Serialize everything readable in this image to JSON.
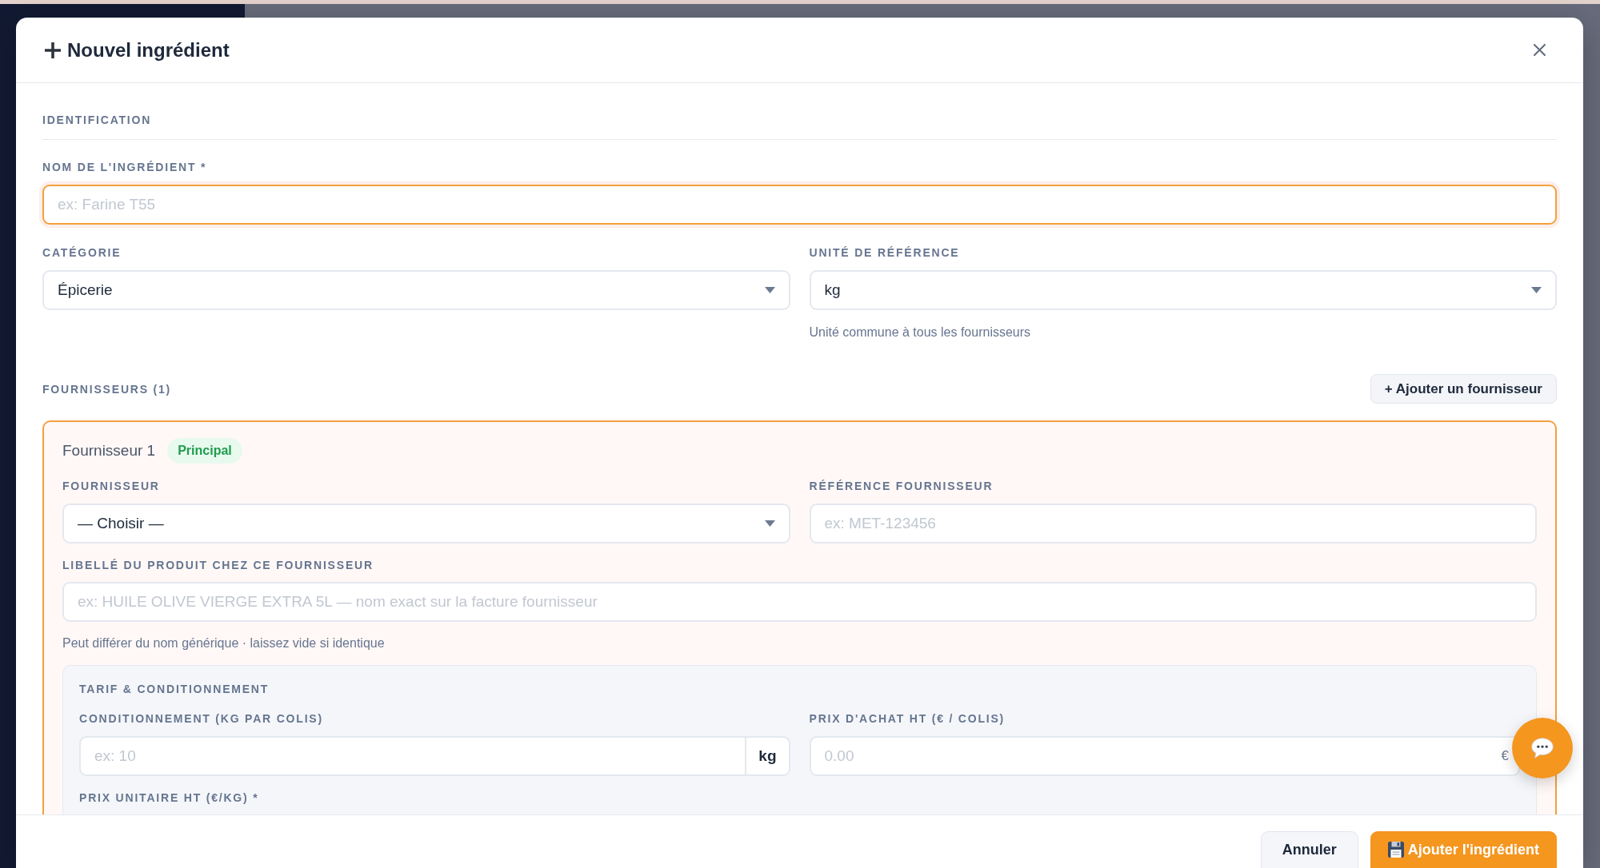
{
  "dialog": {
    "title": "Nouvel ingrédient"
  },
  "identification": {
    "heading": "IDENTIFICATION",
    "name_field": {
      "label": "NOM DE L'INGRÉDIENT *",
      "placeholder": "ex: Farine T55",
      "focused": true
    },
    "category_field": {
      "label": "CATÉGORIE",
      "value": "Épicerie"
    },
    "unit_field": {
      "label": "UNITÉ DE RÉFÉRENCE",
      "value": "kg",
      "hint": "Unité commune à tous les fournisseurs"
    }
  },
  "suppliers": {
    "heading": "FOURNISSEURS (1)",
    "add_button": "+ Ajouter un fournisseur",
    "items": [
      {
        "title": "Fournisseur 1",
        "badge": "Principal",
        "primary": true,
        "supplier_field": {
          "label": "FOURNISSEUR",
          "value": "— Choisir —"
        },
        "reference_field": {
          "label": "RÉFÉRENCE FOURNISSEUR",
          "placeholder": "ex: MET-123456"
        },
        "product_label_field": {
          "label": "LIBELLÉ DU PRODUIT CHEZ CE FOURNISSEUR",
          "placeholder": "ex: HUILE OLIVE VIERGE EXTRA 5L — nom exact sur la facture fournisseur",
          "hint": "Peut différer du nom générique · laissez vide si identique"
        },
        "pricing": {
          "heading": "TARIF & CONDITIONNEMENT",
          "packaging_field": {
            "label": "CONDITIONNEMENT (KG PAR COLIS)",
            "placeholder": "ex: 10",
            "unit": "kg"
          },
          "purchase_price_field": {
            "label": "PRIX D'ACHAT HT (€ / COLIS)",
            "placeholder": "0.00",
            "unit": "€"
          },
          "unit_price_field": {
            "label": "PRIX UNITAIRE HT (€/KG) *"
          }
        }
      }
    ]
  },
  "footer": {
    "buttons": [
      {
        "label": "Annuler",
        "kind": "secondary"
      },
      {
        "label": "Ajouter l'ingrédient",
        "kind": "primary"
      }
    ]
  }
}
